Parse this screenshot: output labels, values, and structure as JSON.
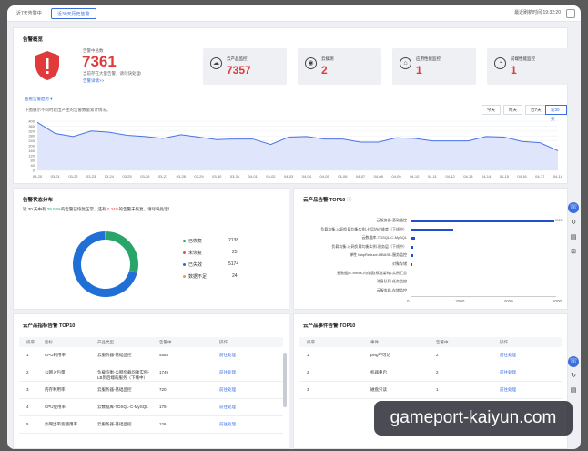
{
  "topbar": {
    "tab1": "近7天告警中",
    "tab2": "近30天历史告警",
    "right": "最近刷新时间 19:32:20"
  },
  "overview": {
    "title": "告警概览",
    "total_label": "告警中总数",
    "total_value": "7361",
    "subtitle": "当前存在大量告警，请尽快处理!",
    "detail_link": "告警详情>>",
    "stats": [
      {
        "label": "云产品监控",
        "value": "7357",
        "icon": "cloud-icon"
      },
      {
        "label": "云拨测",
        "value": "2",
        "icon": "signal-icon"
      },
      {
        "label": "应用性能监控",
        "value": "1",
        "icon": "app-icon"
      },
      {
        "label": "前端性能监控",
        "value": "1",
        "icon": "speed-icon"
      }
    ],
    "trend_link": "查看告警趋势",
    "trend_desc": "下图展示不同时段出产生的告警数量累计情况。",
    "ranges": [
      "今天",
      "昨天",
      "近7天",
      "近30天"
    ],
    "active_range": "近30天"
  },
  "chart_data": {
    "type": "area",
    "x": [
      "03-20",
      "03-21",
      "03-22",
      "03-23",
      "03-24",
      "03-25",
      "03-26",
      "03-27",
      "03-28",
      "03-29",
      "03-30",
      "03-31",
      "04-01",
      "04-02",
      "04-03",
      "04-04",
      "04-05",
      "04-06",
      "04-07",
      "04-08",
      "04-09",
      "04-10",
      "04-11",
      "04-12",
      "04-13",
      "04-14",
      "04-15",
      "04-16",
      "04-17",
      "04-18"
    ],
    "values": [
      390,
      300,
      275,
      320,
      310,
      285,
      275,
      260,
      290,
      270,
      250,
      255,
      255,
      210,
      270,
      275,
      255,
      255,
      230,
      230,
      265,
      260,
      240,
      240,
      240,
      275,
      270,
      235,
      225,
      160
    ],
    "ylim": [
      0,
      400
    ],
    "yticks": [
      0,
      40,
      80,
      120,
      160,
      200,
      240,
      280,
      320,
      360,
      400
    ]
  },
  "distribution": {
    "title": "告警状态分布",
    "sentence_a": "近 30 天中有",
    "sentence_pct1": "29.04%",
    "sentence_b": "的告警已恢复正常，还有",
    "sentence_pct2": "0.34%",
    "sentence_c": "的告警未恢复，请尽快处理！",
    "items": [
      {
        "label": "已恢复",
        "value": "2138",
        "color": "#2aa56a"
      },
      {
        "label": "未恢复",
        "value": "25",
        "color": "#e5533d"
      },
      {
        "label": "已失效",
        "value": "5174",
        "color": "#1f6fd6"
      },
      {
        "label": "数据不足",
        "value": "24",
        "color": "#f0a020"
      }
    ],
    "values": [
      2138,
      25,
      5174,
      24
    ]
  },
  "top_products": {
    "title": "云产品告警 TOP10",
    "labels": [
      "云服务器-基础监控",
      "负载均衡-公网负载均衡实例-七层协议维度（下线中）",
      "云数据库-TDSQL-C-MySQL",
      "负载均衡-公网负载均衡实例-服务层（下线中）",
      "弹性 MapReduce-HBASE-服务监控",
      "对象存储",
      "云数据库-Redis-内存版(标准架构)-实例汇总",
      "消息队列-任务监控",
      "云服务器-存储监控"
    ],
    "values": [
      5920,
      1749,
      179,
      126,
      101,
      60,
      45,
      30,
      20
    ],
    "value_label": "5920",
    "xticks": [
      "0",
      "2000",
      "4000",
      "6000"
    ],
    "xmax": 6000
  },
  "metric_top": {
    "title": "云产品指标告警 TOP10",
    "headers": [
      "排序",
      "指标",
      "产品类型",
      "告警中",
      "操作"
    ],
    "rows": [
      [
        "1",
        "CPU利用率",
        "云服务器-基础监控",
        "4563",
        "前往处理"
      ],
      [
        "2",
        "公网入包量",
        "负载均衡-公网负载均衡实例-LB到后端的服务（下线中）",
        "1749",
        "前往处理"
      ],
      [
        "3",
        "内存利用率",
        "云服务器-基础监控",
        "720",
        "前往处理"
      ],
      [
        "4",
        "CPU使用率",
        "云数据库-TDSQL-C-MySQL",
        "179",
        "前往处理"
      ],
      [
        "5",
        "外网出带宽使用率",
        "云服务器-基础监控",
        "126",
        "前往处理"
      ]
    ]
  },
  "event_top": {
    "title": "云产品事件告警 TOP10",
    "headers": [
      "排序",
      "事件",
      "告警中",
      "操作"
    ],
    "rows": [
      [
        "1",
        "ping不可达",
        "2",
        "前往处理"
      ],
      [
        "2",
        "机器重启",
        "2",
        "前往处理"
      ],
      [
        "3",
        "磁盘只读",
        "1",
        "前往处理"
      ]
    ]
  },
  "watermark": "gameport-kaiyun.com"
}
